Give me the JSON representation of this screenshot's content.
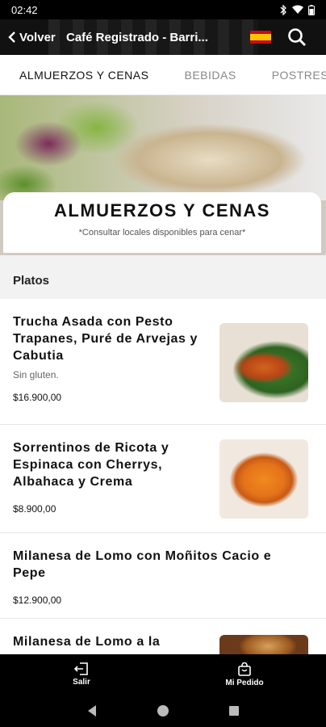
{
  "status_bar": {
    "time": "02:42"
  },
  "header": {
    "back_label": "Volver",
    "title": "Café Registrado - Barri...",
    "flag_icon": "spain-flag-icon",
    "search_icon": "search-icon"
  },
  "tabs": [
    {
      "label": "ALMUERZOS Y CENAS",
      "active": true
    },
    {
      "label": "BEBIDAS",
      "active": false
    },
    {
      "label": "POSTRES",
      "active": false
    }
  ],
  "hero": {
    "title": "ALMUERZOS Y CENAS",
    "subtitle": "*Consultar locales disponibles para cenar*"
  },
  "section": {
    "title": "Platos"
  },
  "items": [
    {
      "name": "Trucha Asada con Pesto Trapanes, Puré de Arvejas y Cabutia",
      "desc": "Sin gluten.",
      "price": "$16.900,00"
    },
    {
      "name": "Sorrentinos de Ricota y Espinaca con Cherrys, Albahaca y Crema",
      "desc": "",
      "price": "$8.900,00"
    },
    {
      "name": "Milanesa de Lomo con Moñitos Cacio e Pepe",
      "desc": "",
      "price": "$12.900,00"
    },
    {
      "name": "Milanesa de Lomo a la",
      "desc": "",
      "price": ""
    }
  ],
  "bottom_nav": {
    "exit_label": "Salir",
    "order_label": "Mi Pedido"
  },
  "colors": {
    "header_bg": "#111111",
    "accent_text": "#111111",
    "muted": "#888888"
  }
}
